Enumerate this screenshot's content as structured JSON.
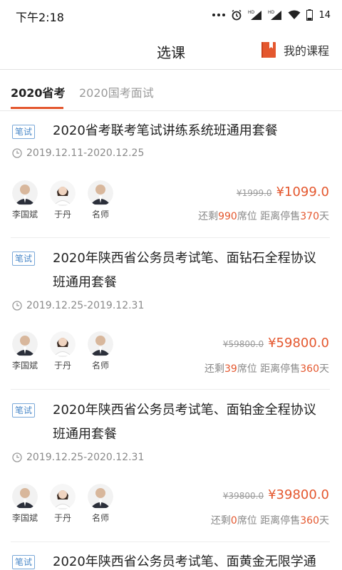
{
  "status_bar": {
    "time": "下午2:18",
    "battery": "14"
  },
  "header": {
    "title": "选课",
    "my_courses_label": "我的课程"
  },
  "tabs": [
    {
      "label": "2020省考",
      "active": true
    },
    {
      "label": "2020国考面试",
      "active": false
    }
  ],
  "courses": [
    {
      "badge": "笔试",
      "title_line1": "2020省考联考笔试讲练系统班通用套餐",
      "title_line2": "",
      "dates": "2019.12.11-2020.12.25",
      "teachers": [
        "李国斌",
        "于丹",
        "名师"
      ],
      "original_price": "¥1999.0",
      "price": "¥1099.0",
      "stock_prefix": "还剩",
      "seats": "990",
      "stock_mid": "席位 距离停售",
      "days": "370",
      "stock_suffix": "天"
    },
    {
      "badge": "笔试",
      "title_line1": "2020年陕西省公务员考试笔、面钻石全程协议",
      "title_line2": "班通用套餐",
      "dates": "2019.12.25-2019.12.31",
      "teachers": [
        "李国斌",
        "于丹",
        "名师"
      ],
      "original_price": "¥59800.0",
      "price": "¥59800.0",
      "stock_prefix": "还剩",
      "seats": "39",
      "stock_mid": "席位 距离停售",
      "days": "360",
      "stock_suffix": "天"
    },
    {
      "badge": "笔试",
      "title_line1": "2020年陕西省公务员考试笔、面铂金全程协议",
      "title_line2": "班通用套餐",
      "dates": "2019.12.25-2020.12.31",
      "teachers": [
        "李国斌",
        "于丹",
        "名师"
      ],
      "original_price": "¥39800.0",
      "price": "¥39800.0",
      "stock_prefix": "还剩",
      "seats": "0",
      "stock_mid": "席位 距离停售",
      "days": "360",
      "stock_suffix": "天"
    },
    {
      "badge": "笔试",
      "title_line1": "2020年陕西省公务员考试笔、面黄金无限学通",
      "title_line2": ""
    }
  ],
  "colors": {
    "accent": "#e4572e",
    "badge_blue": "#4a88c8",
    "muted": "#8a8a8a"
  }
}
